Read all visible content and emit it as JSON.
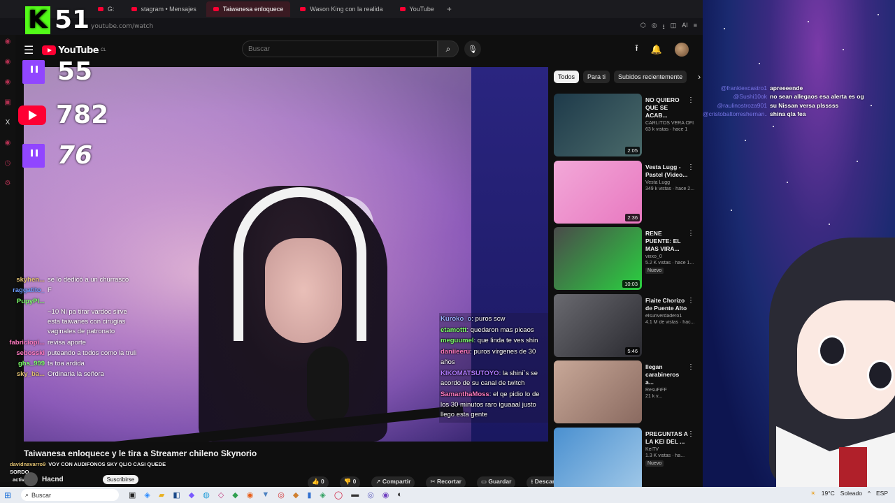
{
  "browser": {
    "tabs": [
      {
        "label": "G:",
        "active": false
      },
      {
        "label": "stagram • Mensajes",
        "active": false
      },
      {
        "label": "Taiwanesa enloquece",
        "active": true
      },
      {
        "label": "Wason King con la realida",
        "active": false
      },
      {
        "label": "YouTube",
        "active": false
      }
    ],
    "new_tab": "+",
    "url": "youtube.com/watch",
    "addr_ai": "AI"
  },
  "sidebar": {
    "x_label": "X"
  },
  "header": {
    "logo_text": "YouTube",
    "logo_region": "CL",
    "search_placeholder": "Buscar"
  },
  "stream_counters": {
    "kick": {
      "letter": "K",
      "count": "51"
    },
    "twitch1": {
      "count": "55"
    },
    "youtube": {
      "count": "782"
    },
    "twitch2": {
      "count": "76"
    }
  },
  "left_chat": [
    {
      "user": "skyhen...",
      "text": "se lo dedicó a un churrasco",
      "color": "#e0c070"
    },
    {
      "user": "raggatito_",
      "text": "F",
      "color": "#6a9cff"
    },
    {
      "user": "PupyPl...",
      "text": "",
      "color": "#7cff6a"
    },
    {
      "user": "",
      "text": "~10 Ni pa tirar vardoc sirve esta taiwanes con cirugias vaginales de patronato",
      "color": "#888"
    },
    {
      "user": "fabriciopi...",
      "text": "revisa aporte",
      "color": "#ff7ac0"
    },
    {
      "user": "sebosski",
      "text": "puteando a todos como la truli",
      "color": "#ff7ac0"
    },
    {
      "user": "ghs_999",
      "text": "ta toa ardida",
      "color": "#7cff6a"
    },
    {
      "user": "sky_ba...",
      "text": "Ordinaria la señora",
      "color": "#e0c070"
    }
  ],
  "overlay_chat": [
    {
      "user": "Kuroko_o",
      "text": ": puros scw",
      "color": "#9ab0ff"
    },
    {
      "user": "etamottt",
      "text": ": quedaron mas picaos",
      "color": "#7cff6a"
    },
    {
      "user": "meguumel",
      "text": ": que linda te ves shin",
      "color": "#7cff6a"
    },
    {
      "user": "daniieeru",
      "text": ": puros virgenes de 30 años",
      "color": "#ff7ac0"
    },
    {
      "user": "KIKOMATSUTOYO",
      "text": ": la shini`s se acordo de su canal de twitch",
      "color": "#b07aff"
    },
    {
      "user": "SamanthaMoss",
      "text": ": el qe pidio lo de los 30 minutos raro iguaaal justo llego esta gente",
      "color": "#ff7ac0"
    }
  ],
  "video": {
    "title": "Taiwanesa enloquece y le tira a Streamer chileno Skynorio",
    "channel": "Hacnd",
    "subscribe": "Suscribirse"
  },
  "bottom_chat": [
    {
      "user": "davidnavarro9",
      "text": "VOY CON AUDIFONOS SKY QLIO CASI QUEDE SORDO"
    },
    {
      "user": "",
      "text": "activa la"
    }
  ],
  "actions": {
    "like": "0",
    "dislike": "0",
    "share": "Compartir",
    "clip": "Recortar",
    "save": "Guardar",
    "download": "Descargar",
    "more": "..."
  },
  "chips": [
    "Todos",
    "Para ti",
    "Subidos recientemente"
  ],
  "recommendations": [
    {
      "title": "NO QUIERO QUE SE ACAB...",
      "channel": "CARLITOS VERA OFI...",
      "meta": "63 k vistas · hace 1",
      "duration": "2:05",
      "badge": "",
      "color1": "#1e3a4a",
      "color2": "#4a6a6a"
    },
    {
      "title": "Vesta Lugg - Pastel (Video...",
      "channel": "Vesta Lugg",
      "meta": "349 k vistas · hace 2...",
      "duration": "2:36",
      "badge": "",
      "color1": "#f2a8d8",
      "color2": "#e878c0"
    },
    {
      "title": "RENE PUENTE: EL MAS VIRA...",
      "channel": "vixxo_0",
      "meta": "5.2 K vistas · hace 1...",
      "duration": "10:03",
      "badge": "Nuevo",
      "color1": "#4a4a4a",
      "color2": "#2ad040"
    },
    {
      "title": "Flaite Chorizo de Puente Alto",
      "channel": "elsuriverdadero1",
      "meta": "4.1 M de vistas · hac...",
      "duration": "5:46",
      "badge": "",
      "color1": "#6a6a70",
      "color2": "#2a2a30"
    },
    {
      "title": "llegan carabineros a...",
      "channel": "ResuFiFF",
      "meta": "21 k v...",
      "duration": "",
      "badge": "",
      "color1": "#c8a898",
      "color2": "#8a6a60"
    },
    {
      "title": "PREGUNTAS A LA KEI DEL ...",
      "channel": "KeiTV",
      "meta": "1.3 K vistas · ha...",
      "duration": "",
      "badge": "Nuevo",
      "color1": "#4a90d0",
      "color2": "#a0c8e8"
    }
  ],
  "right_chat": [
    {
      "user": "@frankiexcastro1",
      "text": "apreeeende"
    },
    {
      "user": "@Sushi10ok",
      "text": "no sean allegaos esa alerta es og"
    },
    {
      "user": "@raulinostroza901",
      "text": "su Nissan versa plsssss"
    },
    {
      "user": "@cristobaltorreshernan...",
      "text": "shina qla fea"
    }
  ],
  "taskbar": {
    "search": "Buscar",
    "weather": "19°C",
    "weather_desc": "Soleado",
    "lang": "ESP"
  }
}
